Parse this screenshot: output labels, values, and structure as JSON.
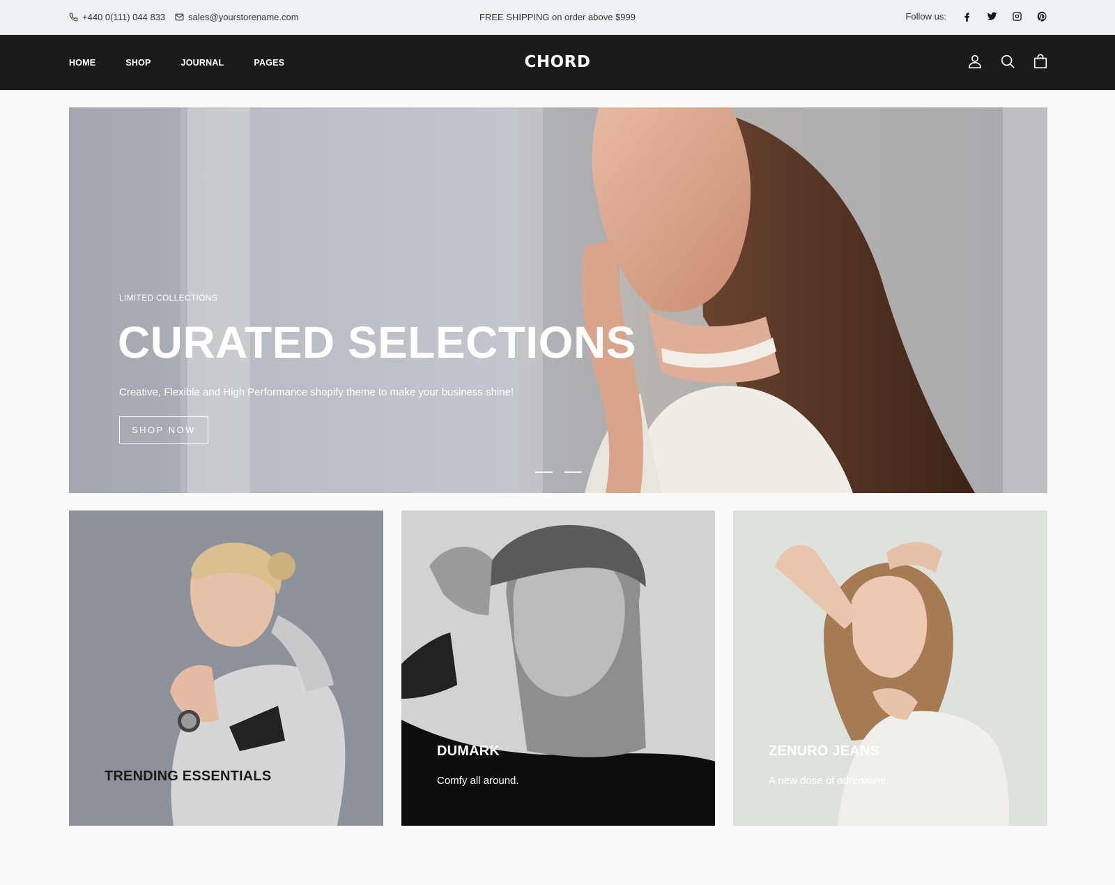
{
  "topbar": {
    "phone": "+440 0(111) 044 833",
    "email": "sales@yourstorename.com",
    "promo": "FREE SHIPPING on order above $999",
    "follow_label": "Follow us:",
    "socials": [
      "facebook-icon",
      "twitter-icon",
      "instagram-icon",
      "pinterest-icon"
    ]
  },
  "nav": {
    "items": [
      "HOME",
      "SHOP",
      "JOURNAL",
      "PAGES"
    ],
    "logo": "CHORD",
    "icons": [
      "user-icon",
      "search-icon",
      "cart-icon"
    ]
  },
  "hero": {
    "kicker": "LIMITED COLLECTIONS",
    "title": "CURATED SELECTIONS",
    "subtitle": "Creative, Flexible and High Performance shopify theme to make your business shine!",
    "cta": "SHOP NOW",
    "slides": 2,
    "active_slide": 1
  },
  "cards": [
    {
      "title": "TRENDING ESSENTIALS",
      "subtitle": ""
    },
    {
      "title": "DUMARK",
      "subtitle": "Comfy all around."
    },
    {
      "title": "ZENURO JEANS",
      "subtitle": "A new dose of adrenaline."
    }
  ],
  "colors": {
    "topbar_bg": "#edf1f5",
    "nav_bg": "#1c1a1b",
    "page_bg": "#fafafa"
  }
}
